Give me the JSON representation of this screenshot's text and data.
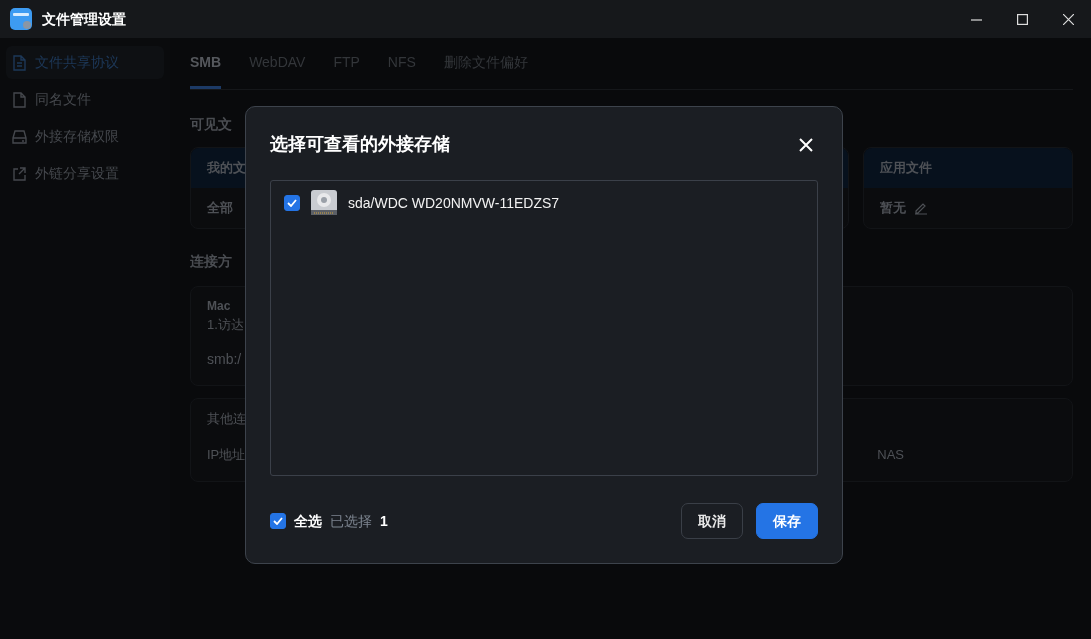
{
  "window": {
    "title": "文件管理设置"
  },
  "sidebar": {
    "items": [
      {
        "label": "文件共享协议",
        "selected": true
      },
      {
        "label": "同名文件",
        "selected": false
      },
      {
        "label": "外接存储权限",
        "selected": false
      },
      {
        "label": "外链分享设置",
        "selected": false
      }
    ]
  },
  "tabs": [
    {
      "label": "SMB",
      "selected": true
    },
    {
      "label": "WebDAV",
      "selected": false
    },
    {
      "label": "FTP",
      "selected": false
    },
    {
      "label": "NFS",
      "selected": false
    },
    {
      "label": "删除文件偏好",
      "selected": false
    }
  ],
  "background": {
    "visible_files_heading": "可见文",
    "table": {
      "columns": [
        "我的文",
        "应用文件"
      ],
      "row": [
        "全部",
        "暂无"
      ]
    },
    "connection_heading": "连接方",
    "mac_card": {
      "title": "Mac",
      "step": "1.访达",
      "address": "smb:/"
    },
    "other_card": {
      "title": "其他连",
      "ip_label": "IP地址",
      "trailing": "NAS"
    }
  },
  "dialog": {
    "title": "选择可查看的外接存储",
    "devices": [
      {
        "name": "sda/WDC WD20NMVW-11EDZS7",
        "checked": true
      }
    ],
    "select_all": {
      "label": "全选",
      "checked": true
    },
    "selected_label": "已选择",
    "selected_count": "1",
    "buttons": [
      {
        "label": "取消",
        "kind": "secondary"
      },
      {
        "label": "保存",
        "kind": "primary"
      }
    ]
  }
}
